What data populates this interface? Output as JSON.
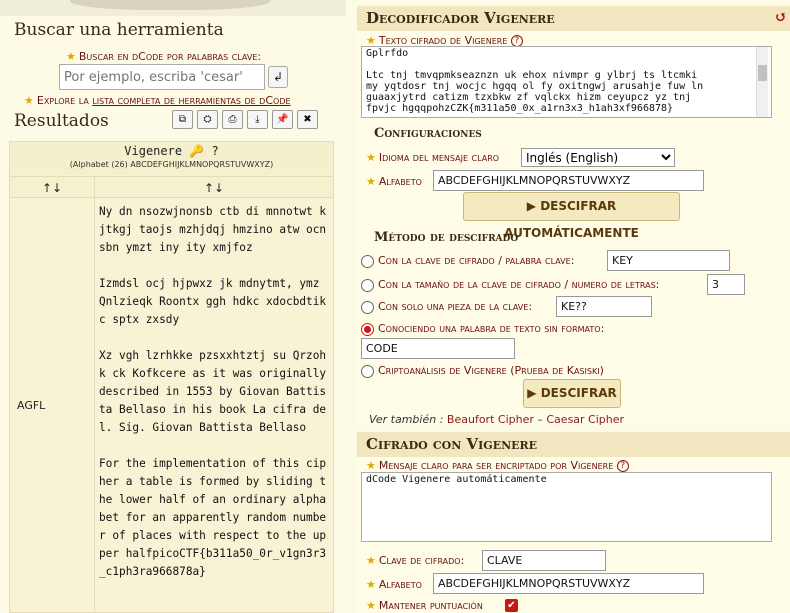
{
  "left": {
    "search_title": "Buscar una herramienta",
    "search_label": "Buscar en dCode por palabras clave:",
    "search_placeholder": "Por ejemplo, escriba 'cesar'",
    "explore_prefix": "Explore la ",
    "explore_link": "lista completa de herramientas de dCode",
    "results_title": "Resultados",
    "results": {
      "method": "Vigenere",
      "alphabet_note": "(Alphabet (26) ABCDEFGHIJKLMNOPQRSTUVWXYZ)",
      "sort_col1": "↑↓",
      "sort_col2": "↑↓",
      "key": "AGFL",
      "text": "Ny dn nsozwjnonsb ctb di mnnotwt kjtkgj taojs mzhjdqj hmzino atw ocnsbn ymzt iny ity xmjfoz\n\nIzmdsl ocj hjpwxz jk mdnytmt, ymz Qnlzieqk Roontx ggh hdkc xdocbdtikc sptx zxsdy\n\nXz vgh lzrhkke pzsxxhtztj su Qrzohk ck Kofkcere as it was originally described in 1553 by Giovan Battista Bellaso in his book La cifra del. Sig. Giovan Battista Bellaso\n\nFor the implementation of this cipher a table is formed by sliding the lower half of an ordinary alphabet for an apparently random number of places with respect to the upper halfpicoCTF{b311a50_0r_v1gn3r3_c1ph3ra966878a}"
    }
  },
  "right": {
    "decoder": {
      "title": "Decodificador Vigenere",
      "ciphertext_label": "Texto cifrado de Vigenere",
      "ciphertext": "Gplrfdo\n\nLtc tnj tmvqpmkseaznzn uk ehox nivmpr g ylbrj ts ltcmki\nmy yqtdosr tnj wocjc hgqq ol fy oxitngwj arusahje fuw ln\nguaaxjytrd catizm tzxbkw zf vqlckx hizm ceyupcz yz tnj\nfpvjc hgqqpohzCZK{m311a50_0x_a1rn3x3_h1ah3xf966878}",
      "config_title": "Configuraciones",
      "language_label": "Idioma del mensaje claro",
      "language_value": "Inglés (English)",
      "alphabet_label": "Alfabeto",
      "alphabet_value": "ABCDEFGHIJKLMNOPQRSTUVWXYZ",
      "auto_button": "DESCIFRAR AUTOMÁTICAMENTE",
      "method_title": "Método de descifrado",
      "opt_key": "Con la clave de cifrado / palabra clave:",
      "opt_key_value": "KEY",
      "opt_length": "Con la tamaño de la clave de cifrado / numero de letras:",
      "opt_length_value": "3",
      "opt_piece": "Con solo una pieza de la clave:",
      "opt_piece_value": "KE??",
      "opt_plainword": "Conociendo una palabra de texto sin formato:",
      "opt_plainword_value": "CODE",
      "opt_kasiski": "Criptoanálisis de Vigenere (Prueba de Kasiski)",
      "decrypt_button": "DESCIFRAR",
      "see_also_prefix": "Ver también : ",
      "see_also_1": "Beaufort Cipher",
      "see_also_sep": " – ",
      "see_also_2": "Caesar Cipher"
    },
    "encoder": {
      "title": "Cifrado con Vigenere",
      "plaintext_label": "Mensaje claro para ser encriptado por Vigenere",
      "plaintext": "dCode Vigenere automáticamente",
      "key_label": "Clave de cifrado:",
      "key_value": "CLAVE",
      "alphabet_label": "Alfabeto",
      "alphabet_value": "ABCDEFGHIJKLMNOPQRSTUVWXYZ",
      "punct_label": "Mantener puntuación"
    }
  }
}
